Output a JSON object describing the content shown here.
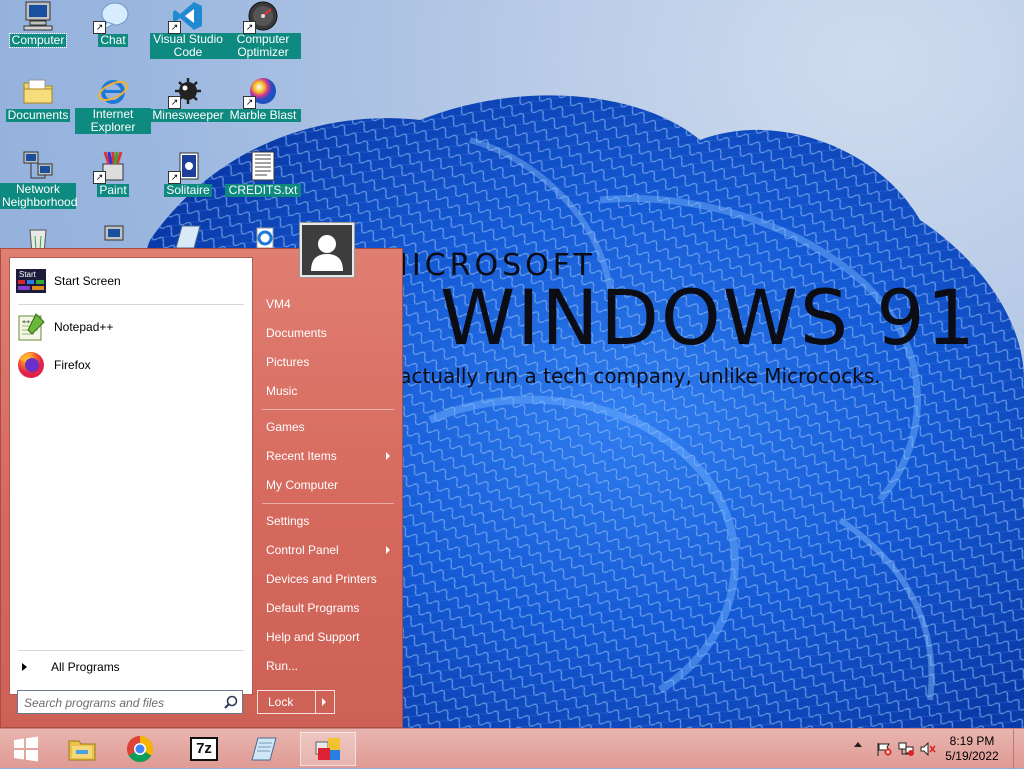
{
  "wallpaper": {
    "brand_small": "MICROSOFT",
    "title": "WINDOWS 91",
    "tagline": "We actually run a tech company, unlike Micrococks."
  },
  "desktop_icons": [
    {
      "label": "Computer",
      "icon": "computer-icon"
    },
    {
      "label": "Chat",
      "icon": "chat-bubble-icon"
    },
    {
      "label": "Visual Studio Code",
      "icon": "vscode-icon"
    },
    {
      "label": "Computer Optimizer",
      "icon": "gauge-icon"
    },
    {
      "label": "Documents",
      "icon": "folder-icon"
    },
    {
      "label": "Internet Explorer",
      "icon": "internet-explorer-icon"
    },
    {
      "label": "Minesweeper",
      "icon": "mine-icon"
    },
    {
      "label": "Marble Blast",
      "icon": "marble-icon"
    },
    {
      "label": "Network Neighborhood",
      "icon": "network-icon"
    },
    {
      "label": "Paint",
      "icon": "paint-icon"
    },
    {
      "label": "Solitaire",
      "icon": "cards-icon"
    },
    {
      "label": "CREDITS.txt",
      "icon": "text-file-icon"
    }
  ],
  "start_menu": {
    "pinned": [
      {
        "label": "Start Screen",
        "icon": "start-screen-icon"
      },
      {
        "label": "Notepad++",
        "icon": "notepadpp-icon"
      },
      {
        "label": "Firefox",
        "icon": "firefox-icon"
      }
    ],
    "all_programs": "All Programs",
    "search_placeholder": "Search programs and files",
    "right_items": [
      {
        "label": "VM4",
        "submenu": false
      },
      {
        "label": "Documents",
        "submenu": false
      },
      {
        "label": "Pictures",
        "submenu": false
      },
      {
        "label": "Music",
        "submenu": false
      },
      {
        "label": "Games",
        "submenu": false
      },
      {
        "label": "Recent Items",
        "submenu": true
      },
      {
        "label": "My Computer",
        "submenu": false
      },
      {
        "label": "Settings",
        "submenu": false
      },
      {
        "label": "Control Panel",
        "submenu": true
      },
      {
        "label": "Devices and Printers",
        "submenu": false
      },
      {
        "label": "Default Programs",
        "submenu": false
      },
      {
        "label": "Help and Support",
        "submenu": false
      },
      {
        "label": "Run...",
        "submenu": false
      }
    ],
    "lock_label": "Lock",
    "start_screen_tile_text": "Start"
  },
  "taskbar": {
    "buttons": [
      "start-button",
      "file-explorer",
      "chrome",
      "7-zip",
      "notepad",
      "tiles"
    ],
    "seven_zip_text": "7z",
    "clock_time": "8:19 PM",
    "clock_date": "5/19/2022"
  },
  "colors": {
    "start_menu": "#d6695d",
    "taskbar": "#e3a49d",
    "icon_label_bg": "#0f8a80"
  }
}
